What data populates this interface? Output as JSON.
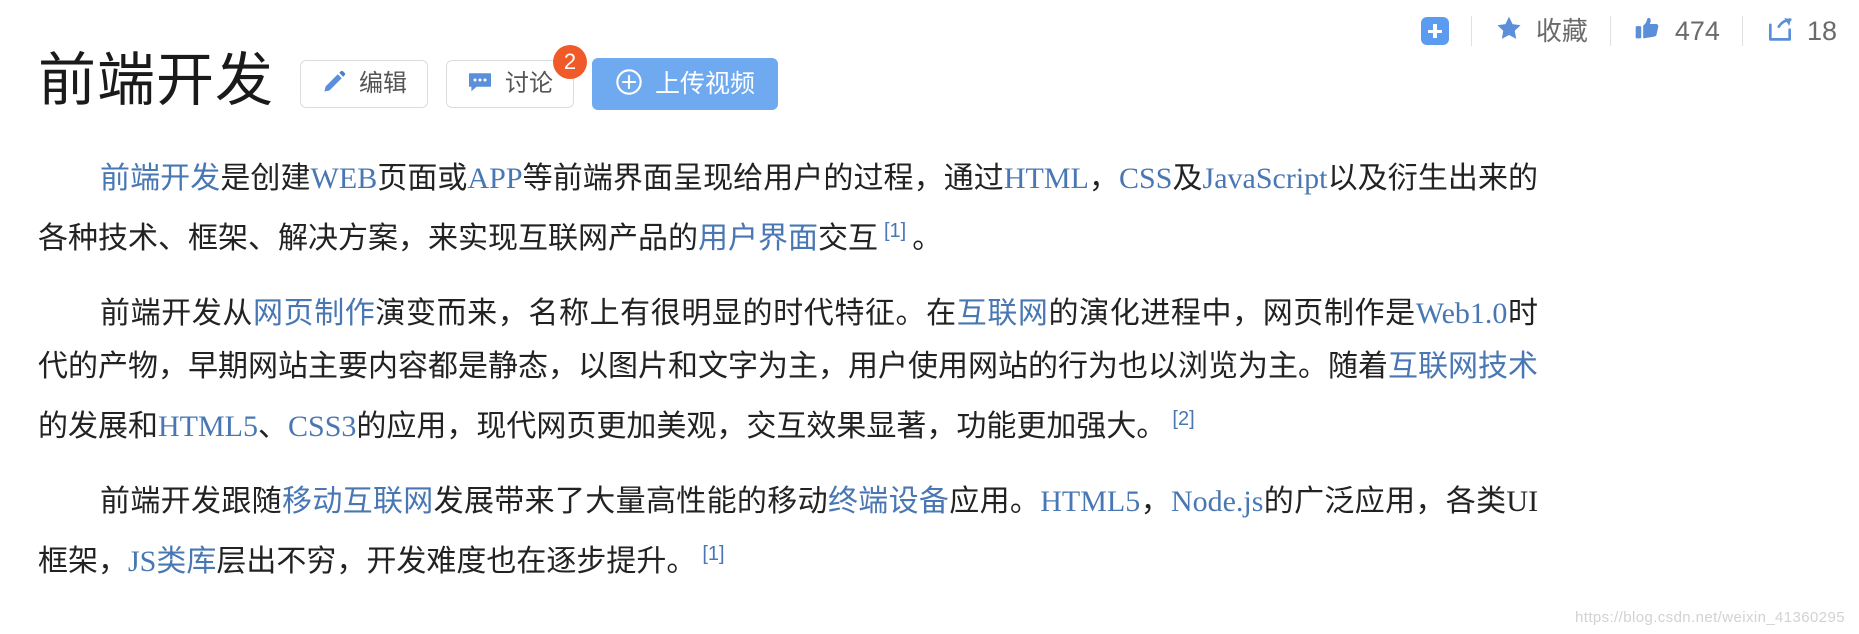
{
  "toolbar": {
    "add_icon": "plus-box-icon",
    "favorite": {
      "icon": "star-icon",
      "label": "收藏"
    },
    "like": {
      "icon": "thumbs-up-icon",
      "count": "474"
    },
    "share": {
      "icon": "share-icon",
      "count": "18"
    }
  },
  "header": {
    "title": "前端开发",
    "edit_button": {
      "icon": "pencil-icon",
      "label": "编辑"
    },
    "discuss_button": {
      "icon": "comment-icon",
      "label": "讨论",
      "badge": "2"
    },
    "upload_button": {
      "icon": "plus-circle-icon",
      "label": "上传视频"
    }
  },
  "article": {
    "paragraphs": [
      {
        "id": "p1",
        "segments": [
          {
            "type": "link",
            "text": "前端开发"
          },
          {
            "type": "text",
            "text": "是创建"
          },
          {
            "type": "link",
            "text": "WEB"
          },
          {
            "type": "text",
            "text": "页面或"
          },
          {
            "type": "link",
            "text": "APP"
          },
          {
            "type": "text",
            "text": "等前端界面呈现给用户的过程，通过"
          },
          {
            "type": "link",
            "text": "HTML"
          },
          {
            "type": "text",
            "text": "，"
          },
          {
            "type": "link",
            "text": "CSS"
          },
          {
            "type": "text",
            "text": "及"
          },
          {
            "type": "link",
            "text": "JavaScript"
          },
          {
            "type": "text",
            "text": "以及衍生出来的各种技术、框架、解决方案，来实现互联网产品的"
          },
          {
            "type": "link",
            "text": "用户界面"
          },
          {
            "type": "text",
            "text": "交互"
          },
          {
            "type": "ref",
            "text": "[1]"
          },
          {
            "type": "text",
            "text": "。"
          }
        ]
      },
      {
        "id": "p2",
        "segments": [
          {
            "type": "text",
            "text": "前端开发从"
          },
          {
            "type": "link",
            "text": "网页制作"
          },
          {
            "type": "text",
            "text": "演变而来，名称上有很明显的时代特征。在"
          },
          {
            "type": "link",
            "text": "互联网"
          },
          {
            "type": "text",
            "text": "的演化进程中，网页制作是"
          },
          {
            "type": "link",
            "text": "Web1.0"
          },
          {
            "type": "text",
            "text": "时代的产物，早期网站主要内容都是静态，以图片和文字为主，用户使用网站的行为也以浏览为主。随着"
          },
          {
            "type": "link",
            "text": "互联网技术"
          },
          {
            "type": "text",
            "text": "的发展和"
          },
          {
            "type": "link",
            "text": "HTML5"
          },
          {
            "type": "text",
            "text": "、"
          },
          {
            "type": "link",
            "text": "CSS3"
          },
          {
            "type": "text",
            "text": "的应用，现代网页更加美观，交互效果显著，功能更加强大。"
          },
          {
            "type": "ref",
            "text": "[2]"
          }
        ]
      },
      {
        "id": "p3",
        "segments": [
          {
            "type": "text",
            "text": "前端开发跟随"
          },
          {
            "type": "link",
            "text": "移动互联网"
          },
          {
            "type": "text",
            "text": "发展带来了大量高性能的移动"
          },
          {
            "type": "link",
            "text": "终端设备"
          },
          {
            "type": "text",
            "text": "应用。"
          },
          {
            "type": "link",
            "text": "HTML5"
          },
          {
            "type": "text",
            "text": "，"
          },
          {
            "type": "link",
            "text": "Node.js"
          },
          {
            "type": "text",
            "text": "的广泛应用，各类UI框架，"
          },
          {
            "type": "link",
            "text": "JS类库"
          },
          {
            "type": "text",
            "text": "层出不穷，开发难度也在逐步提升。"
          },
          {
            "type": "ref",
            "text": "[1]"
          }
        ]
      }
    ]
  },
  "watermark": {
    "text": "https://blog.csdn.net/weixin_41360295"
  },
  "colors": {
    "link": "#4977b3",
    "primary_button": "#6faaf0",
    "badge": "#f05a28",
    "icon_blue": "#5b9bf0"
  }
}
